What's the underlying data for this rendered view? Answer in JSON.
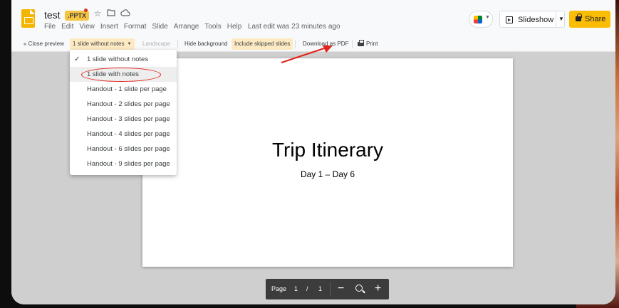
{
  "header": {
    "title": "test",
    "format_badge": ".PPTX",
    "menu": [
      "File",
      "Edit",
      "View",
      "Insert",
      "Format",
      "Slide",
      "Arrange",
      "Tools",
      "Help"
    ],
    "last_edit": "Last edit was 23 minutes ago",
    "slideshow_label": "Slideshow",
    "share_label": "Share"
  },
  "toolbar": {
    "close_preview": "« Close preview",
    "layout_select": "1 slide without notes",
    "landscape": "Landscape",
    "hide_background": "Hide background",
    "include_skipped": "Include skipped slides",
    "download_pdf": "Download as PDF",
    "print": "Print"
  },
  "dropdown": {
    "options": [
      {
        "label": "1 slide without notes",
        "checked": true
      },
      {
        "label": "1 slide with notes",
        "checked": false
      },
      {
        "label": "Handout - 1 slide per page",
        "checked": false
      },
      {
        "label": "Handout - 2 slides per page",
        "checked": false
      },
      {
        "label": "Handout - 3 slides per page",
        "checked": false
      },
      {
        "label": "Handout - 4 slides per page",
        "checked": false
      },
      {
        "label": "Handout - 6 slides per page",
        "checked": false
      },
      {
        "label": "Handout - 9 slides per page",
        "checked": false
      }
    ],
    "check_glyph": "✓"
  },
  "slide": {
    "title": "Trip Itinerary",
    "subtitle": "Day 1 – Day 6"
  },
  "pager": {
    "label": "Page",
    "current": "1",
    "separator": "/",
    "total": "1"
  },
  "colors": {
    "share": "#fbbc04",
    "annotation": "#e3241b",
    "selected_toolbar": "#fde9c2"
  }
}
